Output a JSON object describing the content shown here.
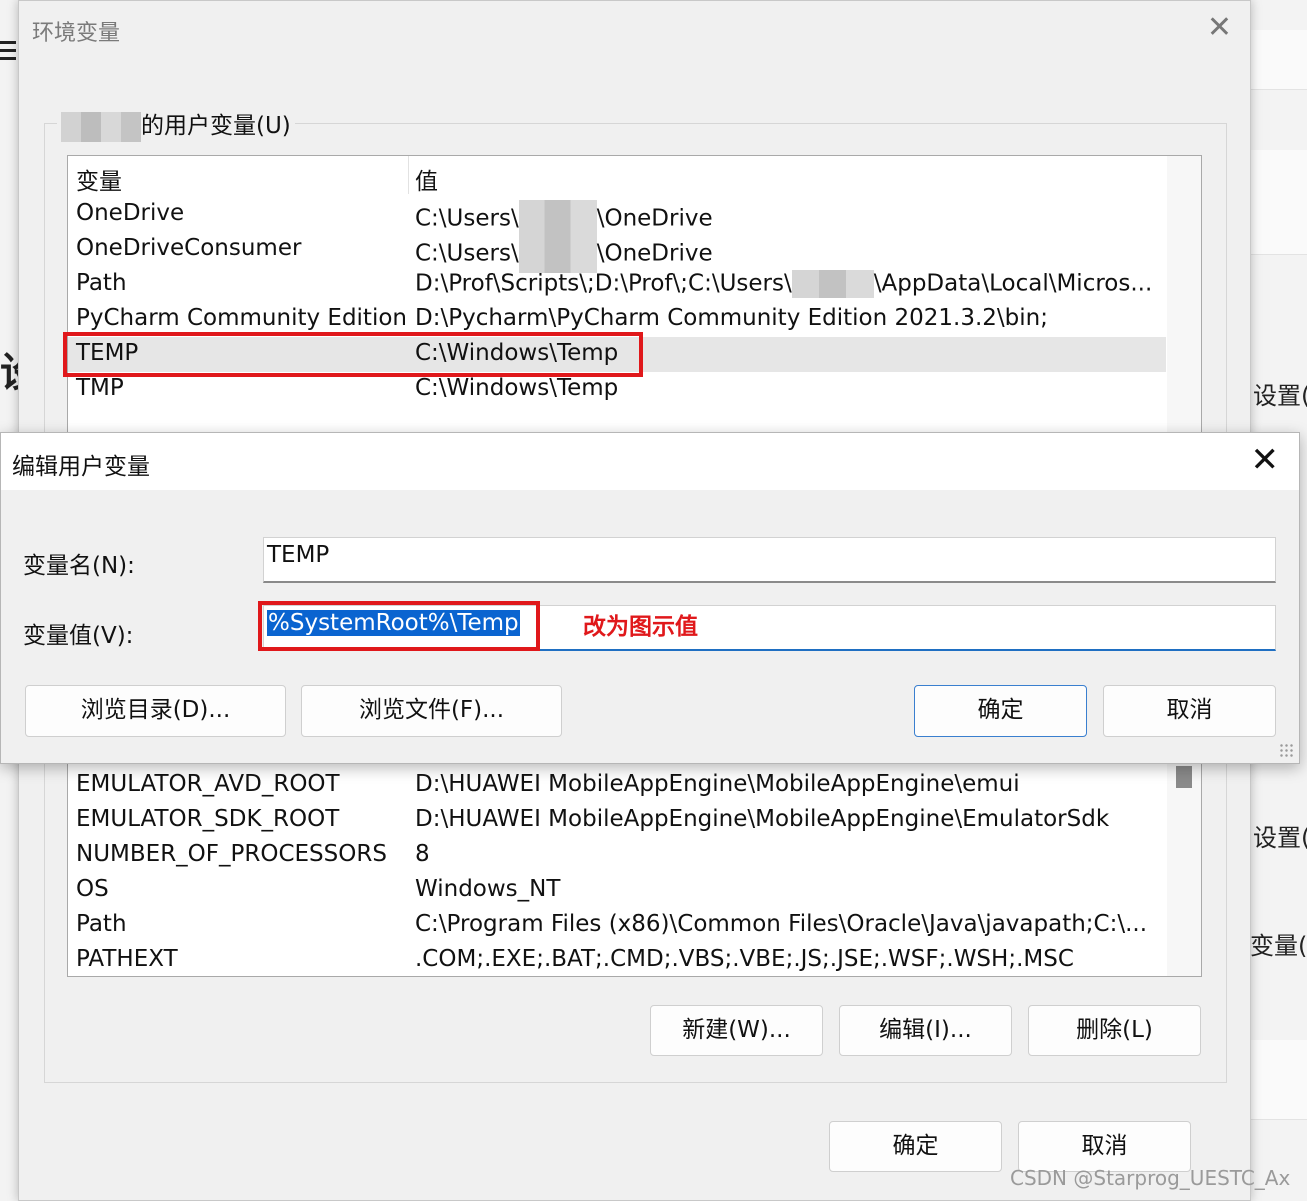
{
  "background_window": {
    "fragments": [
      "设置(",
      "设置(",
      "变量(N",
      "设"
    ]
  },
  "env_dialog": {
    "title": "环境变量",
    "user_group_label": "的用户变量(U)",
    "user_table": {
      "headers": [
        "变量",
        "值"
      ],
      "rows": [
        {
          "name": "OneDrive",
          "value_prefix": "C:\\Users\\",
          "value_suffix": "\\OneDrive"
        },
        {
          "name": "OneDriveConsumer",
          "value_prefix": "C:\\Users\\",
          "value_suffix": "\\OneDrive"
        },
        {
          "name": "Path",
          "value_prefix": "D:\\Prof\\Scripts\\;D:\\Prof\\;C:\\Users\\",
          "value_suffix": "\\AppData\\Local\\Micros..."
        },
        {
          "name": "PyCharm Community Edition",
          "value_prefix": "D:\\Pycharm\\PyCharm Community Edition 2021.3.2\\bin;",
          "value_suffix": ""
        },
        {
          "name": "TEMP",
          "value_prefix": "C:\\Windows\\Temp",
          "value_suffix": ""
        },
        {
          "name": "TMP",
          "value_prefix": "C:\\Windows\\Temp",
          "value_suffix": ""
        }
      ]
    },
    "system_table": {
      "rows": [
        {
          "name": "EMULATOR_AVD_ROOT",
          "value": "D:\\HUAWEI MobileAppEngine\\MobileAppEngine\\emui"
        },
        {
          "name": "EMULATOR_SDK_ROOT",
          "value": "D:\\HUAWEI MobileAppEngine\\MobileAppEngine\\EmulatorSdk"
        },
        {
          "name": "NUMBER_OF_PROCESSORS",
          "value": "8"
        },
        {
          "name": "OS",
          "value": "Windows_NT"
        },
        {
          "name": "Path",
          "value": "C:\\Program Files (x86)\\Common Files\\Oracle\\Java\\javapath;C:\\..."
        },
        {
          "name": "PATHEXT",
          "value": ".COM;.EXE;.BAT;.CMD;.VBS;.VBE;.JS;.JSE;.WSF;.WSH;.MSC"
        }
      ]
    },
    "buttons": {
      "new": "新建(W)...",
      "edit": "编辑(I)...",
      "delete": "删除(L)",
      "ok": "确定",
      "cancel": "取消"
    }
  },
  "edit_dialog": {
    "title": "编辑用户变量",
    "name_label": "变量名(N):",
    "name_value": "TEMP",
    "value_label": "变量值(V):",
    "value_value": "%SystemRoot%\\Temp",
    "annotation": "改为图示值",
    "buttons": {
      "browse_dir": "浏览目录(D)...",
      "browse_file": "浏览文件(F)...",
      "ok": "确定",
      "cancel": "取消"
    }
  },
  "watermark": "CSDN @Starprog_UESTC_Ax",
  "colors": {
    "highlight": "#e0181b",
    "selection": "#0a64d0"
  }
}
